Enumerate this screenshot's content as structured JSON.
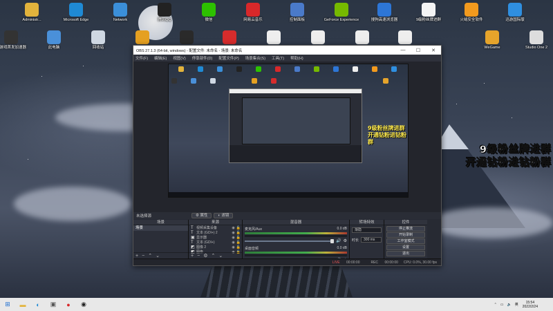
{
  "desktop": {
    "icons": [
      {
        "label": "Administr...",
        "icon": "folder-user-icon",
        "color": "#e2b33c"
      },
      {
        "label": "Microsoft Edge",
        "icon": "edge-icon",
        "color": "#1f8ad4"
      },
      {
        "label": "Network",
        "icon": "network-icon",
        "color": "#3b8fd9"
      },
      {
        "label": "腾讯QQ",
        "icon": "qq-penguin-icon",
        "color": "#222"
      },
      {
        "label": "微信",
        "icon": "wechat-icon",
        "color": "#2dc100"
      },
      {
        "label": "网易云音乐",
        "icon": "netease-music-icon",
        "color": "#d8282a"
      },
      {
        "label": "控制面板",
        "icon": "control-panel-icon",
        "color": "#4a7ac9"
      },
      {
        "label": "GeForce Experience",
        "icon": "nvidia-icon",
        "color": "#76b900"
      },
      {
        "label": "搜狗高速浏览器",
        "icon": "sogou-browser-icon",
        "color": "#2d76d6"
      },
      {
        "label": "9级粉丝牌进群",
        "icon": "text-file-icon",
        "color": "#f4f4f4"
      },
      {
        "label": "火绒安全软件",
        "icon": "huorong-icon",
        "color": "#f29a1e"
      },
      {
        "label": "迅游国际版",
        "icon": "xunyou-icon",
        "color": "#2f8fe0"
      },
      {
        "label": "新游戏首发加速器",
        "icon": "game-accelerator-icon",
        "color": "#333"
      },
      {
        "label": "此电脑",
        "icon": "this-pc-icon",
        "color": "#4a90d9"
      },
      {
        "label": "回收站",
        "icon": "recycle-bin-icon",
        "color": "#cfd8e3"
      },
      {
        "label": "",
        "icon": "owl-app-icon",
        "color": "#e5a021"
      },
      {
        "label": "",
        "icon": "obs-icon",
        "color": "#2a2a2a"
      },
      {
        "label": "",
        "icon": "lips-app-icon",
        "color": "#d62c2c"
      },
      {
        "label": "",
        "icon": "file-icon-1",
        "color": "#eee"
      },
      {
        "label": "",
        "icon": "file-icon-2",
        "color": "#eee"
      },
      {
        "label": "",
        "icon": "file-icon-3",
        "color": "#eee"
      },
      {
        "label": "",
        "icon": "file-icon-4",
        "color": "#eee"
      },
      {
        "label": "WeGame",
        "icon": "wegame-icon",
        "color": "#e6a42b"
      },
      {
        "label": "Studio One 2",
        "icon": "studio-one-icon",
        "color": "#ddd"
      }
    ],
    "promo_lines": [
      "9级粉丝牌进群",
      "开通钻粉进钻粉群"
    ]
  },
  "obs": {
    "title": "OBS 27.1.3 (64-bit, windows) - 配置文件: 未命名 - 场景: 未命名",
    "menu": [
      "文件(F)",
      "编辑(E)",
      "视图(V)",
      "停靠部件(D)",
      "配置文件(P)",
      "场景集合(S)",
      "工具(T)",
      "帮助(H)"
    ],
    "scene_area_label": "未选择源",
    "filter_tabs": [
      "属性",
      "滤镜"
    ],
    "docks": {
      "scenes": {
        "title": "场景",
        "items": [
          "场景"
        ]
      },
      "sources": {
        "title": "来源",
        "items": [
          {
            "icon": "T",
            "name": "视频采集设备"
          },
          {
            "icon": "T",
            "name": "文本 (GDI+) 2"
          },
          {
            "icon": "▣",
            "name": "显示器"
          },
          {
            "icon": "T",
            "name": "文本 (GDI+)"
          },
          {
            "icon": "◩",
            "name": "图像 2"
          },
          {
            "icon": "◩",
            "name": "图像"
          }
        ]
      },
      "mixer": {
        "title": "混音器",
        "channels": [
          {
            "name": "麦克风/Aux",
            "db": "0.0 dB"
          },
          {
            "name": "桌面音频",
            "db": "0.0 dB"
          }
        ]
      },
      "transitions": {
        "title": "转场特效",
        "type": "渐隐",
        "duration_label": "时长",
        "duration": "300 ms"
      },
      "controls": {
        "title": "控件",
        "buttons": [
          "停止推流",
          "开始录制",
          "工作室模式",
          "设置",
          "退出"
        ]
      }
    },
    "status": {
      "live_label": "LIVE",
      "live_time": "00:00:00",
      "rec_label": "REC",
      "rec_time": "00:00:00",
      "cpu": "CPU: 0.0%, 30.00 fps"
    }
  },
  "taskbar": {
    "items": [
      "windows-start-icon",
      "file-explorer-icon",
      "edge-icon",
      "app-icon",
      "netease-music-icon",
      "obs-icon"
    ],
    "time": "15:54",
    "date": "2022/2/24",
    "lang": "英"
  }
}
